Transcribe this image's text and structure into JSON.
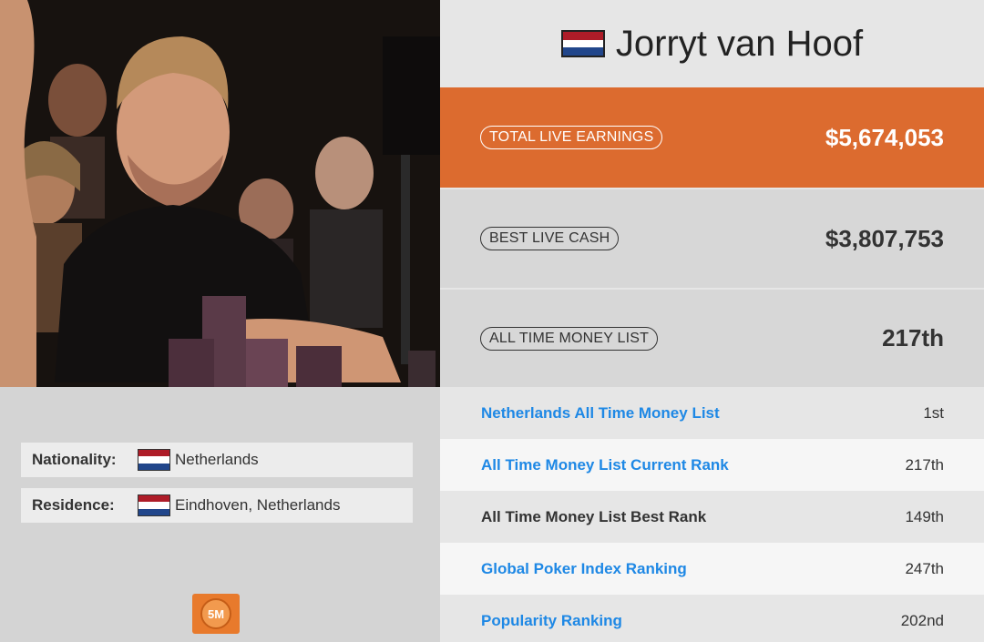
{
  "player": {
    "name": "Jorryt van Hoof",
    "flag_colors": [
      "#ae1c28",
      "#ffffff",
      "#21468b"
    ]
  },
  "details": {
    "nationality_label": "Nationality:",
    "nationality_value": "Netherlands",
    "residence_label": "Residence:",
    "residence_value": "Eindhoven, Netherlands"
  },
  "badge": {
    "text": "5M",
    "color": "#e87a2c"
  },
  "stats": {
    "total_live_earnings_label": "TOTAL LIVE EARNINGS",
    "total_live_earnings_value": "$5,674,053",
    "best_live_cash_label": "BEST LIVE CASH",
    "best_live_cash_value": "$3,807,753",
    "all_time_money_list_label": "ALL TIME MONEY LIST",
    "all_time_money_list_value": "217th"
  },
  "rankings": [
    {
      "label": "Netherlands All Time Money List",
      "value": "1st",
      "link": true
    },
    {
      "label": "All Time Money List Current Rank",
      "value": "217th",
      "link": true
    },
    {
      "label": "All Time Money List Best Rank",
      "value": "149th",
      "link": false
    },
    {
      "label": "Global Poker Index Ranking",
      "value": "247th",
      "link": true
    },
    {
      "label": "Popularity Ranking",
      "value": "202nd",
      "link": true
    }
  ],
  "colors": {
    "accent": "#dc6b2f",
    "link": "#1e88e5"
  }
}
